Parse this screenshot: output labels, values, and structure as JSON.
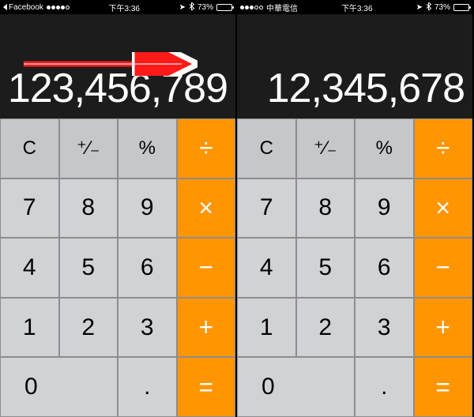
{
  "phones": [
    {
      "status": {
        "back_app": "Facebook",
        "carrier": "",
        "filled_dots": 4,
        "time": "下午3:36",
        "battery_pct": "73%"
      },
      "display_value": "123,456,789",
      "show_arrow": true
    },
    {
      "status": {
        "back_app": "",
        "carrier": "中華電信",
        "filled_dots": 3,
        "time": "下午3:36",
        "battery_pct": "73%"
      },
      "display_value": "12,345,678",
      "show_arrow": false
    }
  ],
  "keys": {
    "clear": "C",
    "plusminus": "⁺∕₋",
    "percent": "%",
    "divide": "÷",
    "seven": "7",
    "eight": "8",
    "nine": "9",
    "multiply": "×",
    "four": "4",
    "five": "5",
    "six": "6",
    "minus": "−",
    "one": "1",
    "two": "2",
    "three": "3",
    "plus": "+",
    "zero": "0",
    "decimal": ".",
    "equals": "="
  },
  "colors": {
    "operator": "#ff9500",
    "function": "#c6c7cb",
    "number": "#d1d2d6",
    "display_bg": "#1c1c1c"
  }
}
